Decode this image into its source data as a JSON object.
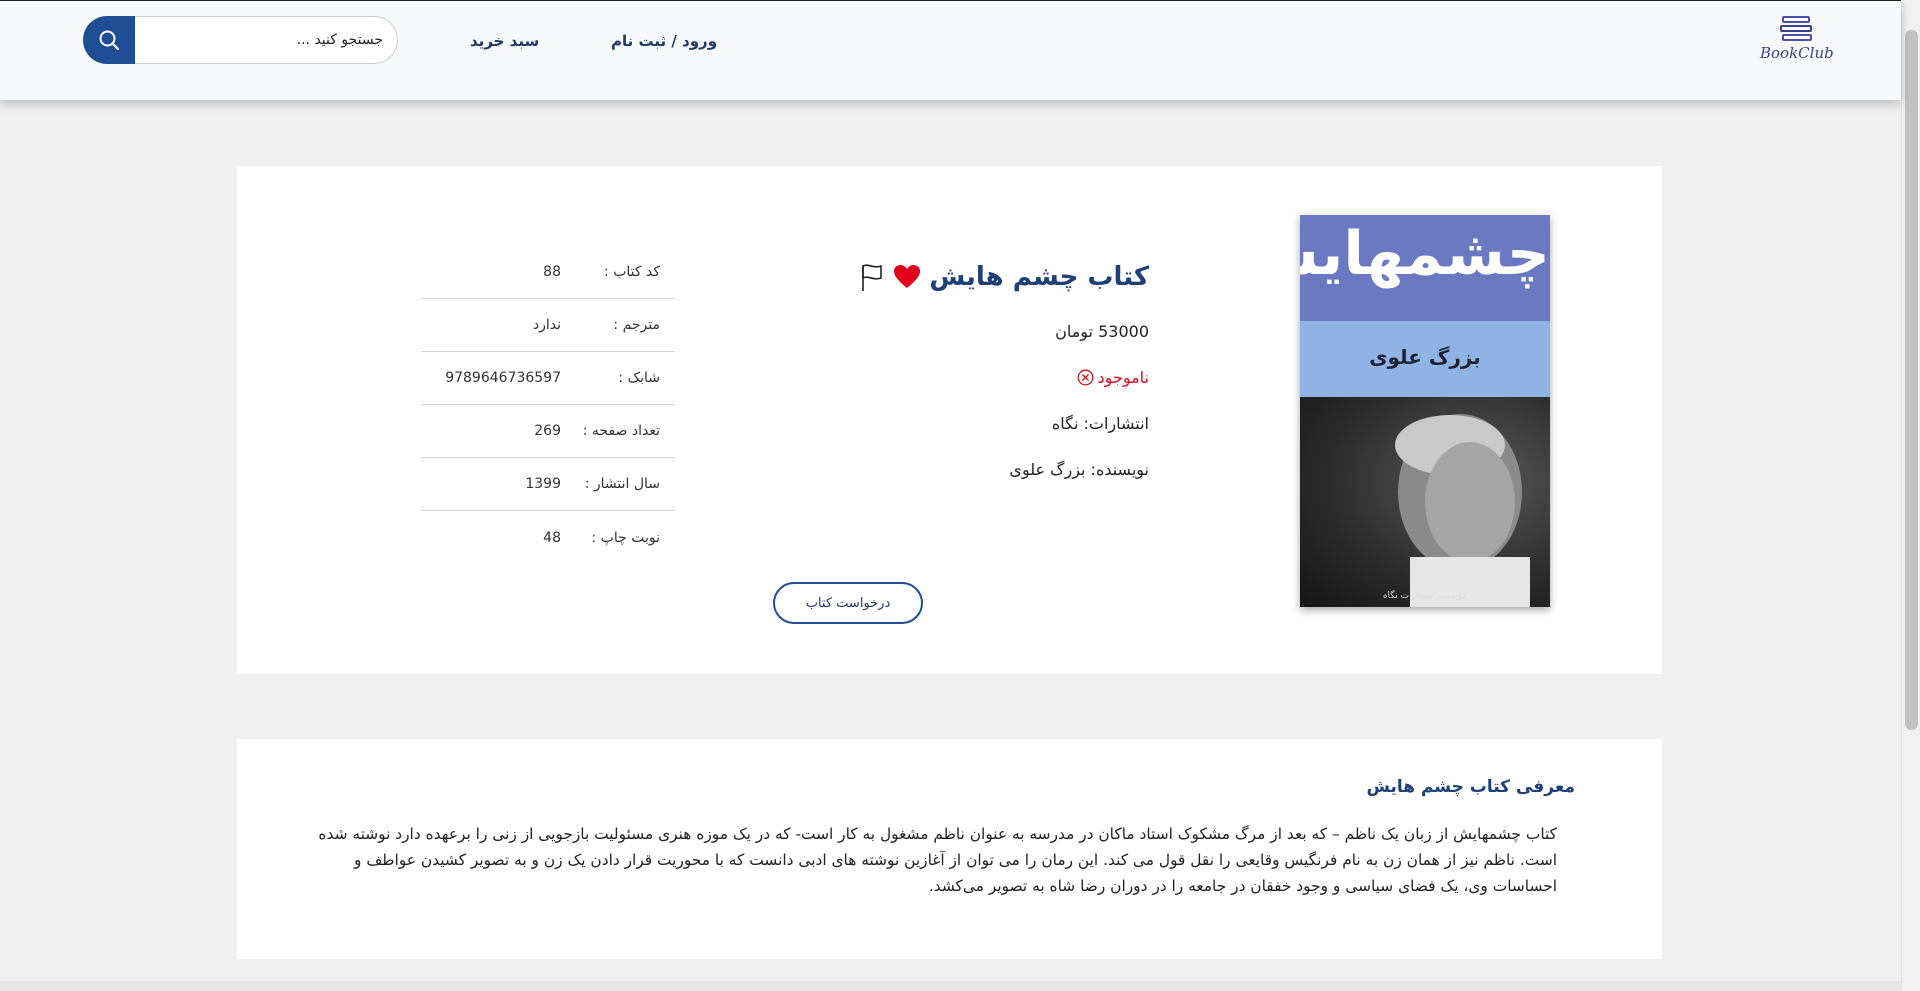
{
  "header": {
    "logo_text": "BookClub",
    "login_label": "ورود / ثبت نام",
    "cart_label": "سبد خرید",
    "search_placeholder": "جستجو کنید ..."
  },
  "book": {
    "cover_title": "چشمهایش",
    "cover_author": "بزرگ علوی",
    "cover_publisher": "موسسه انتشارات نگاه",
    "title": "کتاب چشم هایش",
    "price": "53000 تومان",
    "stock_status": "ناموجود",
    "publisher": "انتشارات: نگاه",
    "author": "نویسنده: بزرگ علوی",
    "request_button": "درخواست کتاب"
  },
  "specs": [
    {
      "label": "کد کتاب :",
      "value": "88"
    },
    {
      "label": "مترجم :",
      "value": "ندارد"
    },
    {
      "label": "شابک :",
      "value": "9789646736597"
    },
    {
      "label": "تعداد صفحه :",
      "value": "269"
    },
    {
      "label": "سال انتشار :",
      "value": "1399"
    },
    {
      "label": "نوبت چاپ :",
      "value": "48"
    }
  ],
  "description": {
    "title": "معرفی کتاب چشم هایش",
    "text": "کتاب چشمهایش از زبان یک ناظم – که بعد از مرگ مشکوک استاد ماکان در مدرسه به عنوان ناظم مشغول به کار است- که در یک موزه هنری مسئولیت بازجویی از زنی را برعهده دارد نوشته شده است. ناظم نیز از همان زن به نام فرنگیس وقایعی را نقل قول می کند. این رمان را می توان از آغازین نوشته های ادبی دانست که با محوریت قرار دادن یک زن و به تصویر کشیدن عواطف و احساسات وی، یک فضای سیاسی و وجود خفقان در جامعه را در دوران رضا شاه به تصویر می‌کشد."
  },
  "colors": {
    "brand": "#1f4d96",
    "title": "#1e3f78",
    "out_of_stock": "#d0141c",
    "favorite": "#e0001b"
  }
}
